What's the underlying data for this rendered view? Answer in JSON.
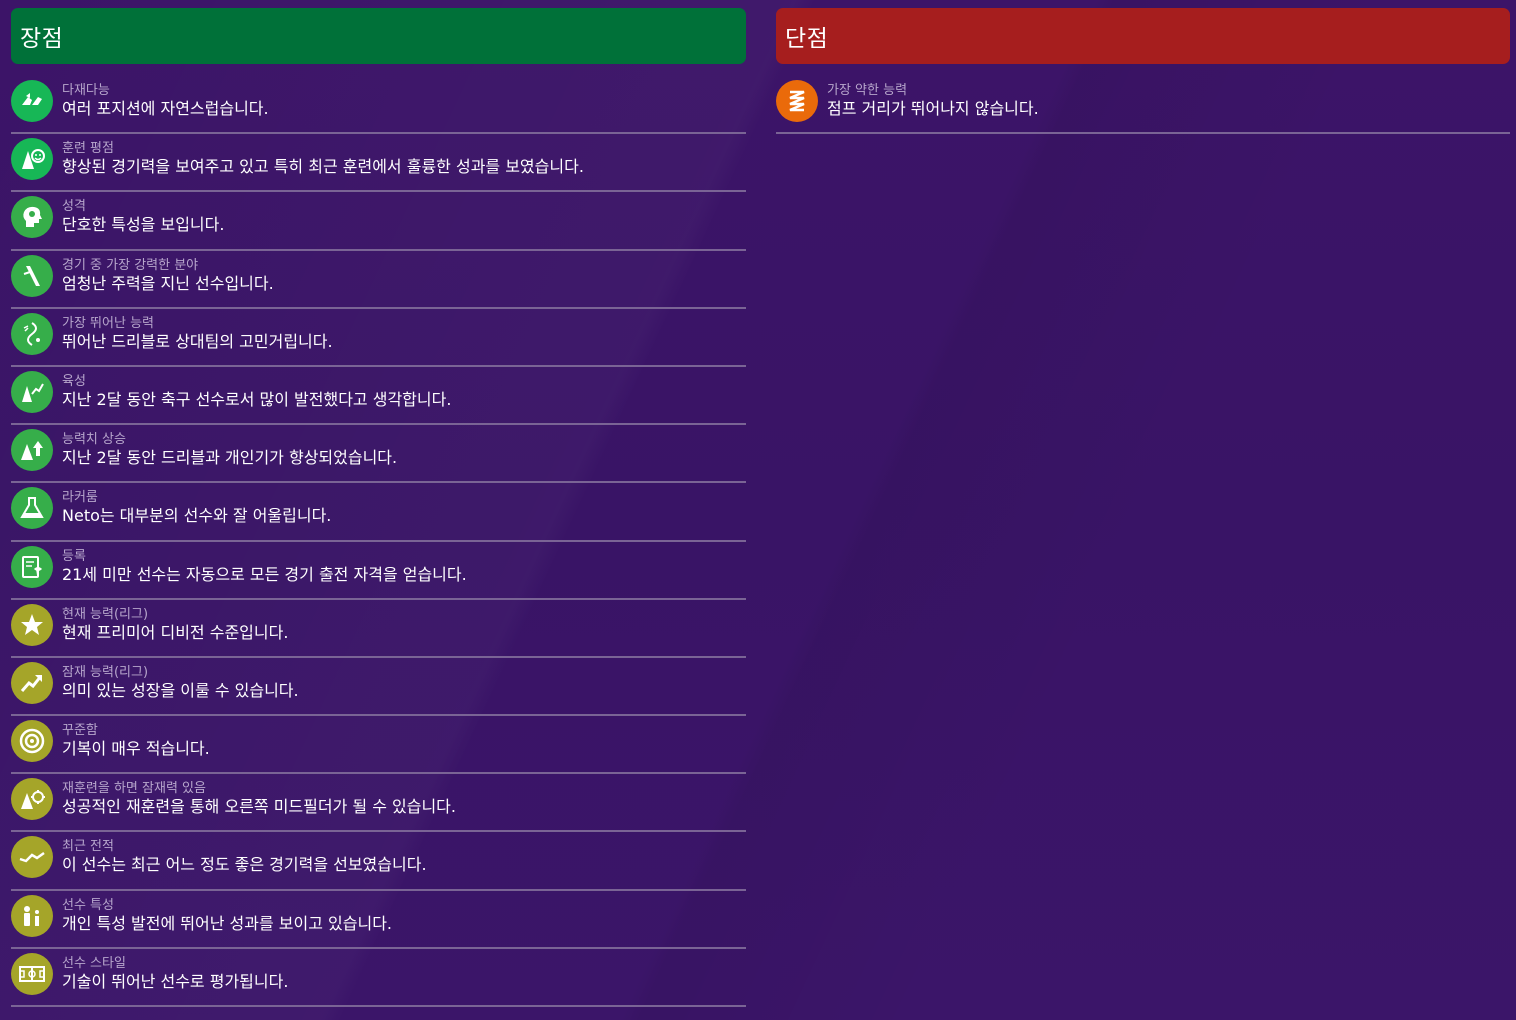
{
  "pros": {
    "title": "장점",
    "color": "#007139",
    "items": [
      {
        "icon": "versatility-icon",
        "label": "다재다능",
        "desc": "여러 포지션에 자연스럽습니다."
      },
      {
        "icon": "training-rating-icon",
        "label": "훈련 평점",
        "desc": "향상된 경기력을 보여주고 있고 특히 최근 훈련에서 훌륭한 성과를 보였습니다."
      },
      {
        "icon": "personality-icon",
        "label": "성격",
        "desc": "단호한 특성을 보입니다."
      },
      {
        "icon": "strongest-area-icon",
        "label": "경기 중 가장 강력한 분야",
        "desc": "엄청난 주력을 지닌 선수입니다."
      },
      {
        "icon": "best-ability-icon",
        "label": "가장 뛰어난 능력",
        "desc": "뛰어난 드리블로 상대팀의 고민거립니다."
      },
      {
        "icon": "development-icon",
        "label": "육성",
        "desc": "지난 2달 동안 축구 선수로서 많이 발전했다고 생각합니다."
      },
      {
        "icon": "attribute-rise-icon",
        "label": "능력치 상승",
        "desc": "지난 2달 동안 드리블과 개인기가 향상되었습니다."
      },
      {
        "icon": "flask-icon",
        "label": "라커룸",
        "desc": "Neto는 대부분의 선수와 잘 어울립니다."
      },
      {
        "icon": "registration-icon",
        "label": "등록",
        "desc": "21세 미만 선수는 자동으로 모든 경기 출전 자격을 얻습니다."
      },
      {
        "icon": "star-icon",
        "label": "현재 능력(리그)",
        "desc": "현재 프리미어 디비전 수준입니다."
      },
      {
        "icon": "trend-up-icon",
        "label": "잠재 능력(리그)",
        "desc": "의미 있는 성장을 이룰 수 있습니다."
      },
      {
        "icon": "target-icon",
        "label": "꾸준함",
        "desc": "기복이 매우 적습니다."
      },
      {
        "icon": "retrain-icon",
        "label": "재훈련을 하면 잠재력 있음",
        "desc": "성공적인 재훈련을 통해 오른쪽 미드필더가 될 수 있습니다."
      },
      {
        "icon": "recent-form-icon",
        "label": "최근 전적",
        "desc": "이 선수는 최근 어느 정도 좋은 경기력을 선보였습니다."
      },
      {
        "icon": "player-traits-icon",
        "label": "선수 특성",
        "desc": "개인 특성 발전에 뛰어난 성과를 보이고 있습니다."
      },
      {
        "icon": "pitch-icon",
        "label": "선수 스타일",
        "desc": "기술이 뛰어난 선수로 평가됩니다."
      }
    ]
  },
  "cons": {
    "title": "단점",
    "color": "#a61e1e",
    "items": [
      {
        "icon": "spring-icon",
        "label": "가장 약한 능력",
        "desc": "점프 거리가 뛰어나지 않습니다."
      }
    ]
  }
}
